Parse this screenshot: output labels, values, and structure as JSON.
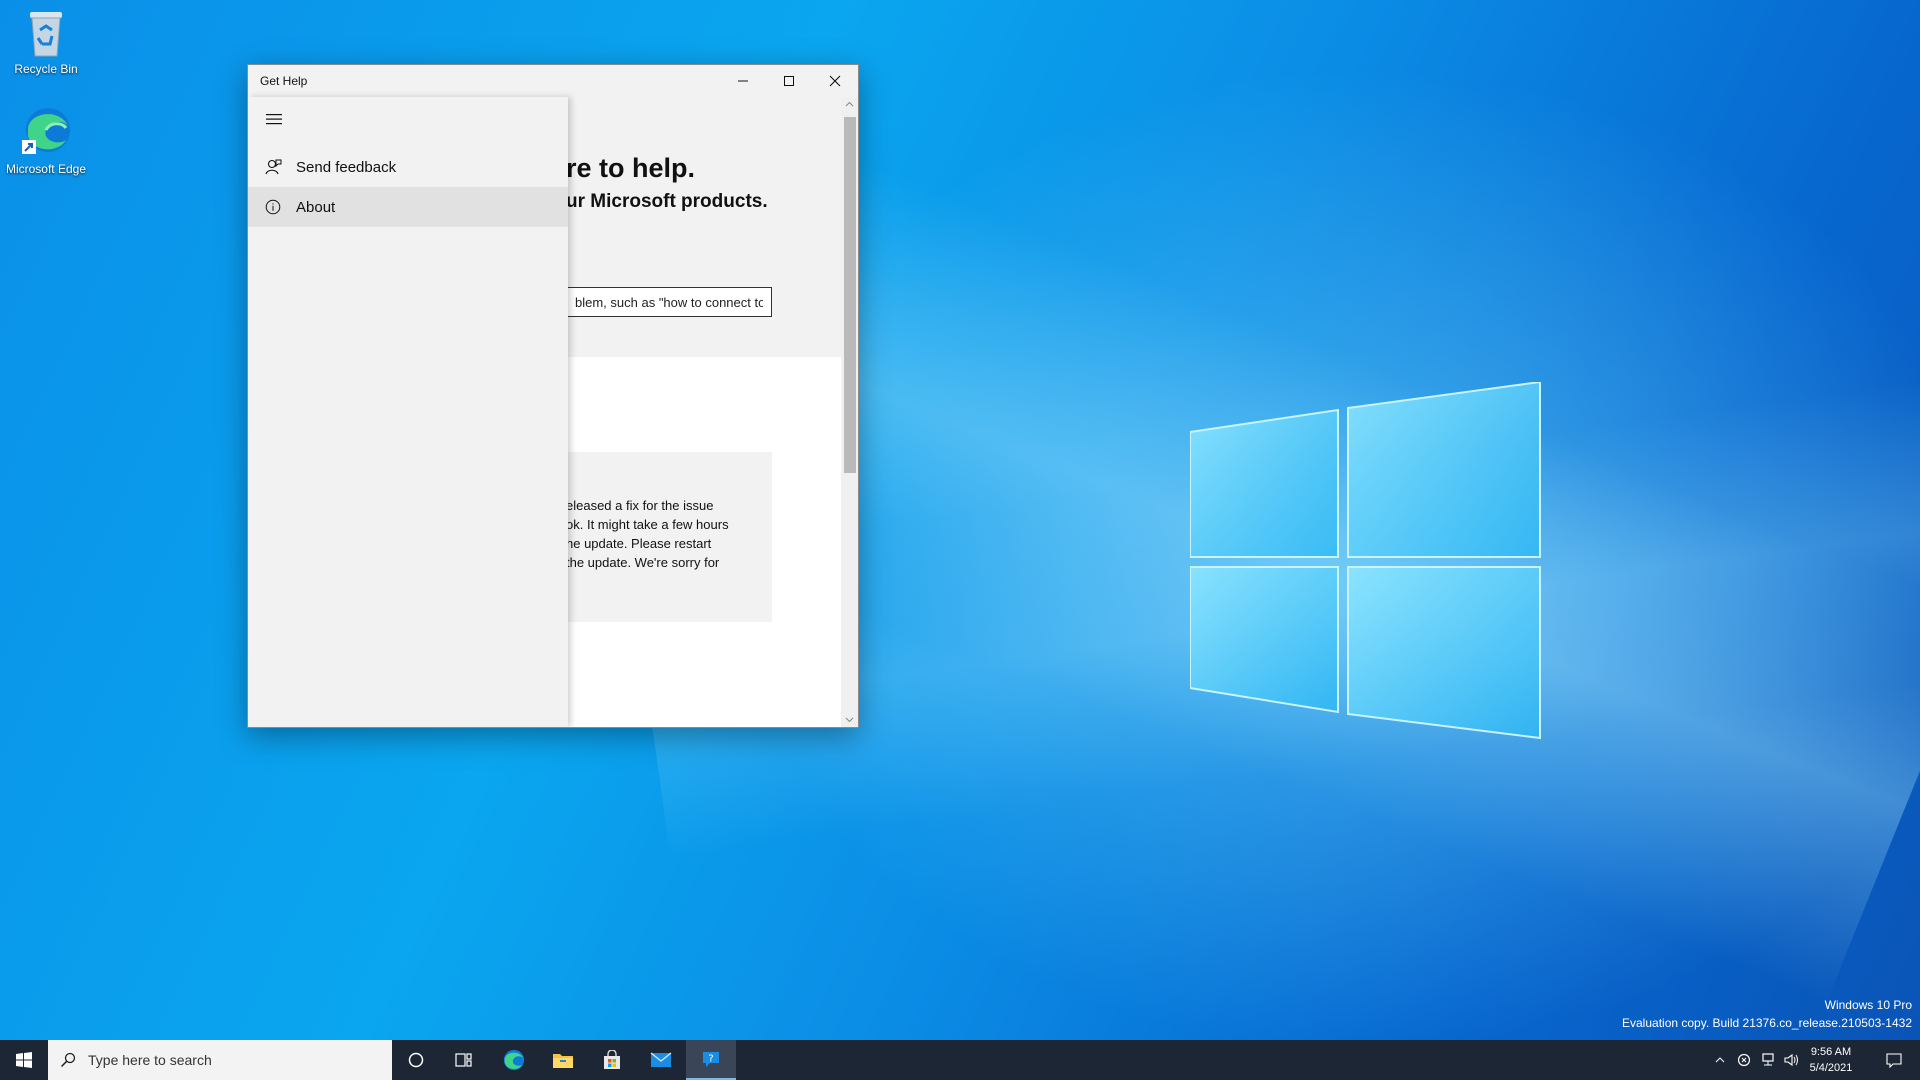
{
  "desktop": {
    "icons": [
      {
        "label": "Recycle Bin"
      },
      {
        "label": "Microsoft Edge"
      }
    ],
    "watermark": {
      "line1": "Windows 10 Pro",
      "line2": "Evaluation copy. Build 21376.co_release.210503-1432"
    }
  },
  "window": {
    "title": "Get Help",
    "hero": {
      "heading": "re to help.",
      "subheading": "ur Microsoft products."
    },
    "search": {
      "value": "blem, such as \"how to connect to"
    },
    "notice": {
      "body": "eleased a fix for the issue\nok. It might take a few hours\nhe update. Please restart\nthe update. We're sorry for"
    },
    "nav": {
      "items": [
        {
          "label": "Send feedback",
          "icon": "feedback-person-icon"
        },
        {
          "label": "About",
          "icon": "info-icon"
        }
      ]
    }
  },
  "taskbar": {
    "search_placeholder": "Type here to search",
    "time": "9:56 AM",
    "date": "5/4/2021",
    "accent": "#1d2634"
  }
}
